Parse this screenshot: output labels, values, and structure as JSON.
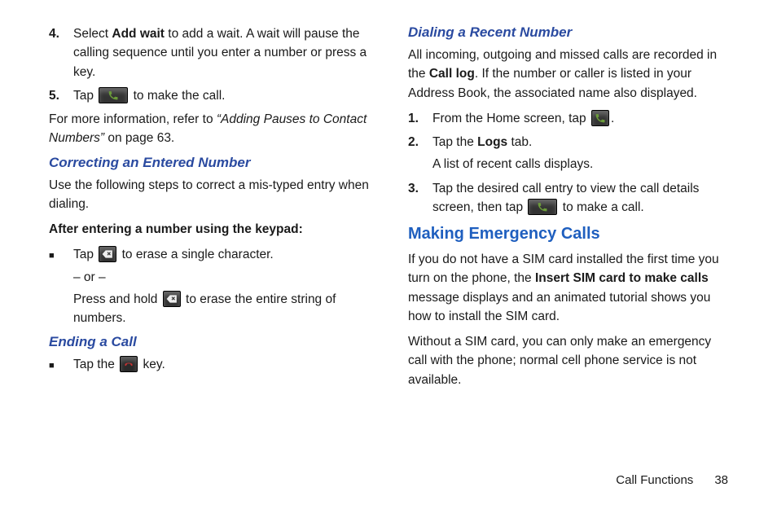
{
  "left": {
    "step4": {
      "num": "4.",
      "pre": "Select ",
      "bold": "Add wait",
      "post": " to add a wait. A wait will pause the calling sequence until you enter a number or press a key."
    },
    "step5": {
      "num": "5.",
      "pre": "Tap ",
      "post": " to make the call."
    },
    "ref": {
      "pre": "For more information, refer to ",
      "italic": "“Adding Pauses to Contact Numbers” ",
      "post": " on page 63."
    },
    "h_correcting": "Correcting an Entered Number",
    "correcting_intro": "Use the following steps to correct a mis-typed entry when dialing.",
    "after_heading": "After entering a number using the keypad:",
    "erase_single_pre": "Tap ",
    "erase_single_post": " to erase a single character.",
    "or": "– or –",
    "erase_hold_pre": "Press and hold ",
    "erase_hold_post": " to erase the entire string of numbers.",
    "h_ending": "Ending a Call",
    "ending_pre": "Tap the ",
    "ending_post": " key."
  },
  "right": {
    "h_dialing": "Dialing a Recent Number",
    "dialing_intro_pre": "All incoming, outgoing and missed calls are recorded in the ",
    "dialing_intro_bold": "Call log",
    "dialing_intro_post": ". If the number or caller is listed in your Address Book, the associated name also displayed.",
    "step1": {
      "num": "1.",
      "pre": "From the Home screen, tap ",
      "post": "."
    },
    "step2": {
      "num": "2.",
      "pre": "Tap the ",
      "bold": "Logs",
      "post": " tab.",
      "line2": "A list of recent calls displays."
    },
    "step3": {
      "num": "3.",
      "pre": "Tap the desired call entry to view the call details screen, then tap ",
      "post": " to make a call."
    },
    "h_emergency": "Making Emergency Calls",
    "em1_pre": "If you do not have a SIM card installed the first time you turn on the phone, the ",
    "em1_bold": "Insert SIM card to make calls",
    "em1_post": " message displays and an animated tutorial shows you how to install the SIM card.",
    "em2": "Without a SIM card, you can only make an emergency call with the phone; normal cell phone service is not available."
  },
  "footer": {
    "section": "Call Functions",
    "page": "38"
  },
  "icons": {
    "call": "call-icon",
    "backspace": "backspace-icon",
    "endcall": "endcall-icon",
    "phoneapp": "phone-app-icon"
  }
}
